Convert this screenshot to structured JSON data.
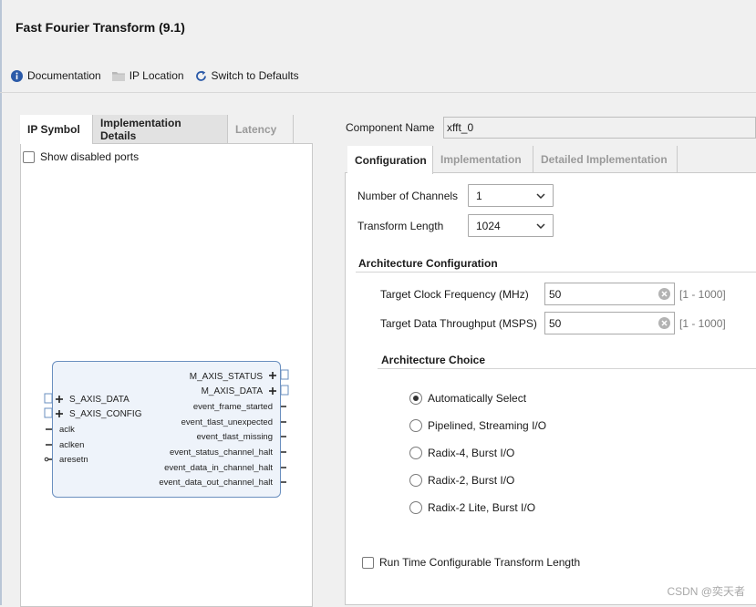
{
  "window": {
    "title": "Fast Fourier Transform (9.1)"
  },
  "toolbar": {
    "documentation": "Documentation",
    "ip_location": "IP Location",
    "switch_defaults": "Switch to Defaults"
  },
  "left_panel": {
    "tabs": [
      "IP Symbol",
      "Implementation Details",
      "Latency"
    ],
    "show_disabled_ports": "Show disabled ports",
    "ip_symbol": {
      "left_ports": [
        "S_AXIS_DATA",
        "S_AXIS_CONFIG",
        "aclk",
        "aclken",
        "aresetn"
      ],
      "right_ports": [
        "M_AXIS_STATUS",
        "M_AXIS_DATA",
        "event_frame_started",
        "event_tlast_unexpected",
        "event_tlast_missing",
        "event_status_channel_halt",
        "event_data_in_channel_halt",
        "event_data_out_channel_halt"
      ]
    }
  },
  "component": {
    "label": "Component Name",
    "value": "xfft_0"
  },
  "right_panel": {
    "tabs": [
      "Configuration",
      "Implementation",
      "Detailed Implementation"
    ],
    "num_channels": {
      "label": "Number of Channels",
      "value": "1"
    },
    "transform_length": {
      "label": "Transform Length",
      "value": "1024"
    },
    "arch_config": {
      "title": "Architecture Configuration",
      "clock_freq": {
        "label": "Target Clock Frequency (MHz)",
        "value": "50",
        "range": "[1 - 1000]"
      },
      "throughput": {
        "label": "Target Data Throughput (MSPS)",
        "value": "50",
        "range": "[1 - 1000]"
      }
    },
    "arch_choice": {
      "title": "Architecture Choice",
      "options": [
        "Automatically Select",
        "Pipelined, Streaming I/O",
        "Radix-4, Burst I/O",
        "Radix-2, Burst I/O",
        "Radix-2 Lite, Burst I/O"
      ],
      "selected": "Automatically Select"
    },
    "runtime_config": "Run Time Configurable Transform Length"
  },
  "watermark": "CSDN @奕天者",
  "colors": {
    "accent": "#6a8fbf",
    "ip_fill": "#eef3fa",
    "info_icon": "#2b5aa8"
  }
}
